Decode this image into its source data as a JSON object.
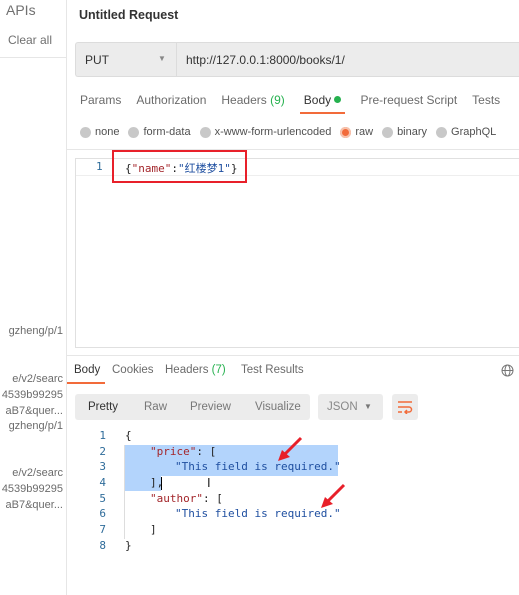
{
  "sidebar": {
    "apis": "APIs",
    "clear_all": "Clear all",
    "history": [
      "gzheng/p/1",
      "e/v2/searc",
      "4539b99295",
      "aB7&quer...",
      "gzheng/p/1",
      "e/v2/searc",
      "4539b99295",
      "aB7&quer..."
    ]
  },
  "request": {
    "title": "Untitled Request",
    "method": "PUT",
    "url": "http://127.0.0.1:8000/books/1/",
    "tabs": {
      "params": "Params",
      "authorization": "Authorization",
      "headers": "Headers",
      "headers_count": "(9)",
      "body": "Body",
      "pre_request": "Pre-request Script",
      "tests": "Tests"
    },
    "body_types": [
      "none",
      "form-data",
      "x-www-form-urlencoded",
      "raw",
      "binary",
      "GraphQL"
    ],
    "selected_body_type": "raw",
    "body_line": "1",
    "body": {
      "open": "{",
      "key": "\"name\"",
      "colon": ":",
      "value": "\"红楼梦1\"",
      "close": "}"
    }
  },
  "response": {
    "tabs": {
      "body": "Body",
      "cookies": "Cookies",
      "headers": "Headers",
      "headers_count": "(7)",
      "tests": "Test Results"
    },
    "views": [
      "Pretty",
      "Raw",
      "Preview",
      "Visualize"
    ],
    "format": "JSON",
    "lines": [
      "1",
      "2",
      "3",
      "4",
      "5",
      "6",
      "7",
      "8"
    ],
    "code": {
      "l1": "{",
      "price_key": "\"price\"",
      "l2rest": ": [",
      "msg": "\"This field is required.\"",
      "l4": "],",
      "author_key": "\"author\"",
      "l5rest": ": [",
      "l7": "]",
      "l8": "}"
    }
  },
  "colors": {
    "accent": "#f26b3a",
    "green": "#26b14f",
    "highlight": "#b3d4fc",
    "annotation": "#e8202a"
  }
}
